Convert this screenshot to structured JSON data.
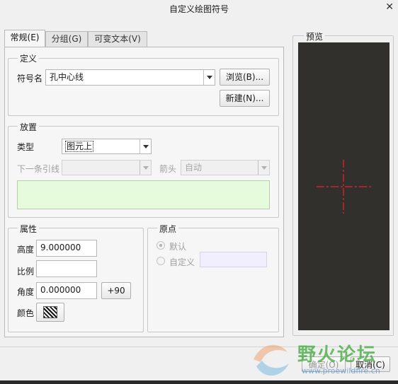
{
  "window": {
    "title": "自定义绘图符号"
  },
  "tabs": [
    {
      "label": "常规(E)"
    },
    {
      "label": "分组(G)"
    },
    {
      "label": "可变文本(V)"
    }
  ],
  "definition": {
    "legend": "定义",
    "symbol_name_label": "符号名",
    "symbol_name_value": "孔中心线",
    "browse_label": "浏览(B)...",
    "new_label": "新建(N)..."
  },
  "placement": {
    "legend": "放置",
    "type_label": "类型",
    "type_value": "图元上",
    "next_leader_label": "下一条引线",
    "next_leader_value": "",
    "arrow_label": "箭头",
    "arrow_value": "自动"
  },
  "properties": {
    "legend": "属性",
    "height_label": "高度",
    "height_value": "9.000000",
    "scale_label": "比例",
    "scale_value": "",
    "angle_label": "角度",
    "angle_value": "0.000000",
    "rotate_label": "+90",
    "color_label": "颜色"
  },
  "origin": {
    "legend": "原点",
    "default_label": "默认",
    "custom_label": "自定义",
    "selected": "default"
  },
  "preview": {
    "legend": "预览",
    "background": "#32302c",
    "crosshair_color": "#e8202a"
  },
  "footer": {
    "ok_label": "确定(O)",
    "cancel_label": "取消(C)"
  },
  "watermark": {
    "text": "野火论坛",
    "url": "www.proewildfire.cn"
  }
}
